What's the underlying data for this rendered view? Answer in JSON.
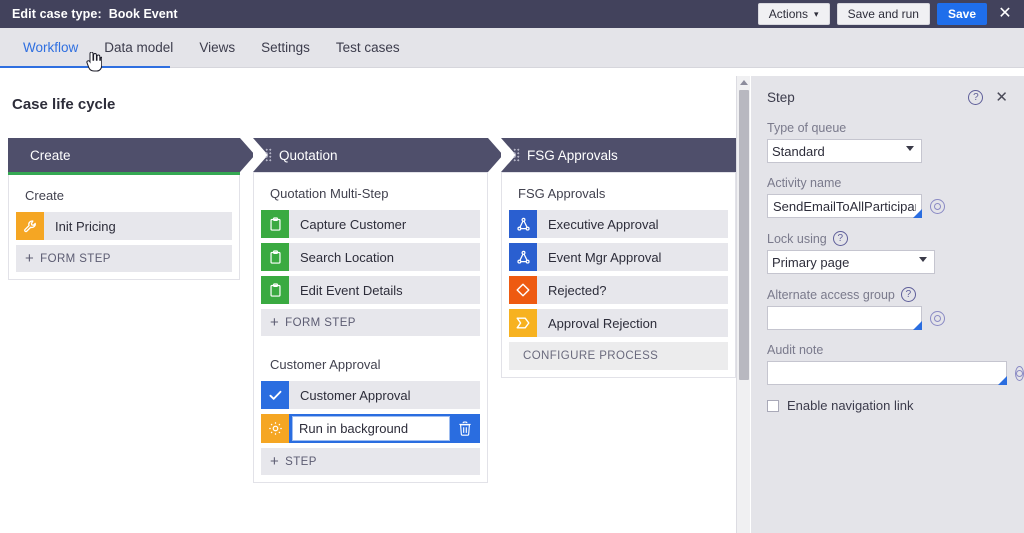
{
  "topbar": {
    "label": "Edit case type:",
    "case_name": "Book Event",
    "actions_label": "Actions",
    "caret": "⌄",
    "save_and_run_label": "Save and run",
    "save_label": "Save",
    "close_label": "✕",
    "bg_color": "#42425c",
    "primary_color": "#1f6eeb"
  },
  "tabs": [
    {
      "label": "Workflow",
      "active": true
    },
    {
      "label": "Data model",
      "active": false
    },
    {
      "label": "Views",
      "active": false
    },
    {
      "label": "Settings",
      "active": false
    },
    {
      "label": "Test cases",
      "active": false
    }
  ],
  "canvas": {
    "title": "Case life cycle",
    "stages": [
      {
        "name": "Create",
        "accent_color": "#35a853",
        "processes": [
          {
            "title": "Create",
            "steps": [
              {
                "label": "Init Pricing",
                "icon": "wrench-icon",
                "icon_color": "#f5a623"
              }
            ],
            "add_label": "FORM STEP"
          }
        ]
      },
      {
        "name": "Quotation",
        "processes": [
          {
            "title": "Quotation Multi-Step",
            "steps": [
              {
                "label": "Capture Customer",
                "icon": "clipboard-icon",
                "icon_color": "#3aaa41"
              },
              {
                "label": "Search Location",
                "icon": "clipboard-icon",
                "icon_color": "#3aaa41"
              },
              {
                "label": "Edit Event Details",
                "icon": "clipboard-icon",
                "icon_color": "#3aaa41"
              }
            ],
            "add_label": "FORM STEP"
          },
          {
            "title": "Customer Approval",
            "steps": [
              {
                "label": "Customer Approval",
                "icon": "check-icon",
                "icon_color": "#2a6de0"
              }
            ],
            "editing_step": {
              "value": "Run in background",
              "icon": "gear-icon",
              "icon_color": "#f5a623",
              "delete_label": "delete-icon"
            },
            "add_label": "STEP"
          }
        ]
      },
      {
        "name": "FSG Approvals",
        "processes": [
          {
            "title": "FSG Approvals",
            "steps": [
              {
                "label": "Executive Approval",
                "icon": "approval-tree-icon",
                "icon_color": "#2a5fd0"
              },
              {
                "label": "Event Mgr Approval",
                "icon": "approval-tree-icon",
                "icon_color": "#2a5fd0"
              },
              {
                "label": "Rejected?",
                "icon": "decision-diamond-icon",
                "icon_color": "#ee5a11"
              },
              {
                "label": "Approval Rejection",
                "icon": "chevron-flag-icon",
                "icon_color": "#f7b220"
              }
            ],
            "configure_label": "CONFIGURE PROCESS"
          }
        ]
      }
    ]
  },
  "panel": {
    "title": "Step",
    "help_label": "?",
    "close_label": "✕",
    "fields": {
      "type_of_queue": {
        "label": "Type of queue",
        "value": "Standard"
      },
      "activity_name": {
        "label": "Activity name",
        "value": "SendEmailToAllParticipants"
      },
      "lock_using": {
        "label": "Lock using",
        "value": "Primary page",
        "help": "?"
      },
      "alternate_access_group": {
        "label": "Alternate access group",
        "value": "",
        "help": "?"
      },
      "audit_note": {
        "label": "Audit note",
        "value": ""
      }
    },
    "checkbox": {
      "label": "Enable navigation link",
      "checked": false
    }
  }
}
